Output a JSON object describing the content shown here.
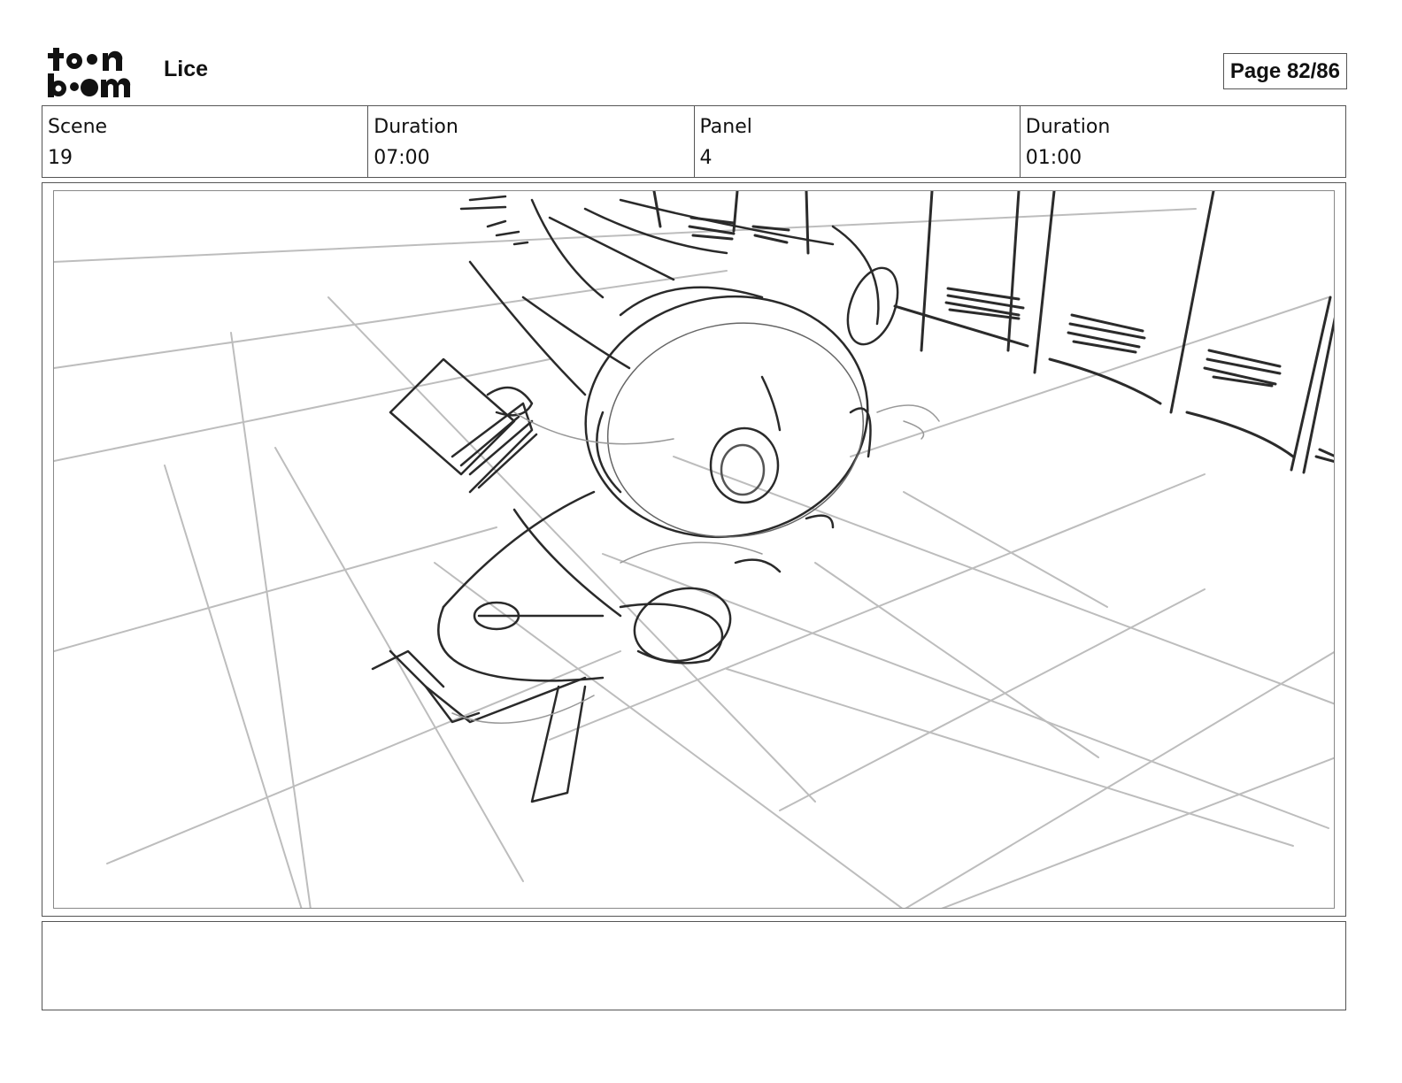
{
  "header": {
    "logo_name": "toon-boom-logo",
    "project_title": "Lice",
    "page_label": "Page 82/86"
  },
  "info": {
    "scene_label": "Scene",
    "scene_value": "19",
    "scene_duration_label": "Duration",
    "scene_duration_value": "07:00",
    "panel_label": "Panel",
    "panel_value": "4",
    "panel_duration_label": "Duration",
    "panel_duration_value": "01:00"
  },
  "panel": {
    "image_name": "storyboard-sketch"
  },
  "notes": {
    "text": ""
  }
}
